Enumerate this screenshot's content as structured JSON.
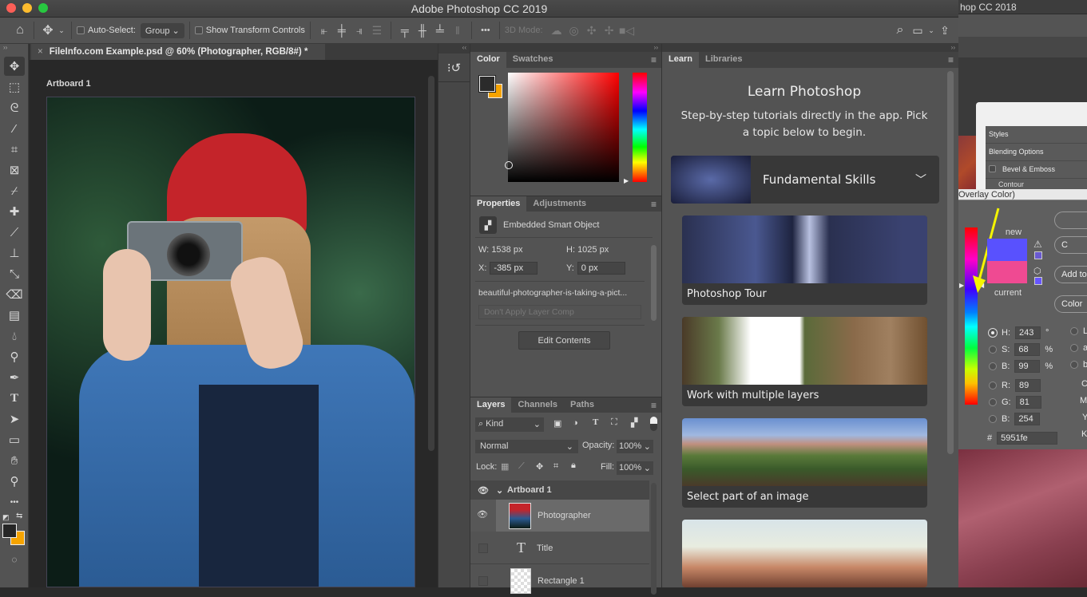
{
  "window": {
    "title": "Adobe Photoshop CC 2019",
    "bg_window_title": "hop CC 2018"
  },
  "options_bar": {
    "auto_select_label": "Auto-Select:",
    "auto_select_value": "Group",
    "show_transform_label": "Show Transform Controls",
    "mode_3d_label": "3D Mode:",
    "more": "•••"
  },
  "document": {
    "tab_title": "FileInfo.com Example.psd @ 60% (Photographer, RGB/8#) *",
    "artboard_label": "Artboard 1"
  },
  "color_panel": {
    "tabs": [
      "Color",
      "Swatches"
    ],
    "foreground": "#2b2b2b",
    "background": "#f5a300"
  },
  "properties_panel": {
    "tabs": [
      "Properties",
      "Adjustments"
    ],
    "type": "Embedded Smart Object",
    "w_label": "W:",
    "w_value": "1538 px",
    "h_label": "H:",
    "h_value": "1025 px",
    "x_label": "X:",
    "x_value": "-385 px",
    "y_label": "Y:",
    "y_value": "0 px",
    "filename": "beautiful-photographer-is-taking-a-pict...",
    "layer_comp": "Don't Apply Layer Comp",
    "edit_button": "Edit Contents"
  },
  "layers_panel": {
    "tabs": [
      "Layers",
      "Channels",
      "Paths"
    ],
    "filter": "Kind",
    "blend_mode": "Normal",
    "opacity_label": "Opacity:",
    "opacity": "100%",
    "lock_label": "Lock:",
    "fill_label": "Fill:",
    "fill": "100%",
    "layers": [
      {
        "name": "Artboard 1",
        "type": "artboard",
        "visible": true
      },
      {
        "name": "Photographer",
        "type": "smart-object",
        "visible": true,
        "selected": true
      },
      {
        "name": "Title",
        "type": "text",
        "visible": false
      },
      {
        "name": "Rectangle 1",
        "type": "shape",
        "visible": false
      }
    ]
  },
  "learn_panel": {
    "tabs": [
      "Learn",
      "Libraries"
    ],
    "title": "Learn Photoshop",
    "subtitle": "Step-by-step tutorials directly in the app. Pick a topic below to begin.",
    "section": "Fundamental Skills",
    "tutorials": [
      "Photoshop Tour",
      "Work with multiple layers",
      "Select part of an image",
      ""
    ]
  },
  "bg_layer_style": {
    "items": [
      "Styles",
      "Blending Options",
      "Bevel & Emboss",
      "Contour"
    ],
    "picker_title": "Overlay Color)"
  },
  "color_picker": {
    "new_label": "new",
    "current_label": "current",
    "new_color": "#5951fe",
    "current_color": "#ef4a92",
    "buttons": [
      "",
      "C",
      "Add to",
      "Color"
    ],
    "h_label": "H:",
    "h": "243",
    "h_unit": "°",
    "s_label": "S:",
    "s": "68",
    "s_unit": "%",
    "b_label": "B:",
    "b": "99",
    "b_unit": "%",
    "r_label": "R:",
    "r": "89",
    "g_label": "G:",
    "g": "81",
    "bl_label": "B:",
    "bl": "254",
    "hex_label": "#",
    "hex": "5951fe",
    "lab_labels": [
      "L",
      "a",
      "b"
    ],
    "cmyk_labels": [
      "C",
      "M",
      "Y",
      "K"
    ]
  }
}
